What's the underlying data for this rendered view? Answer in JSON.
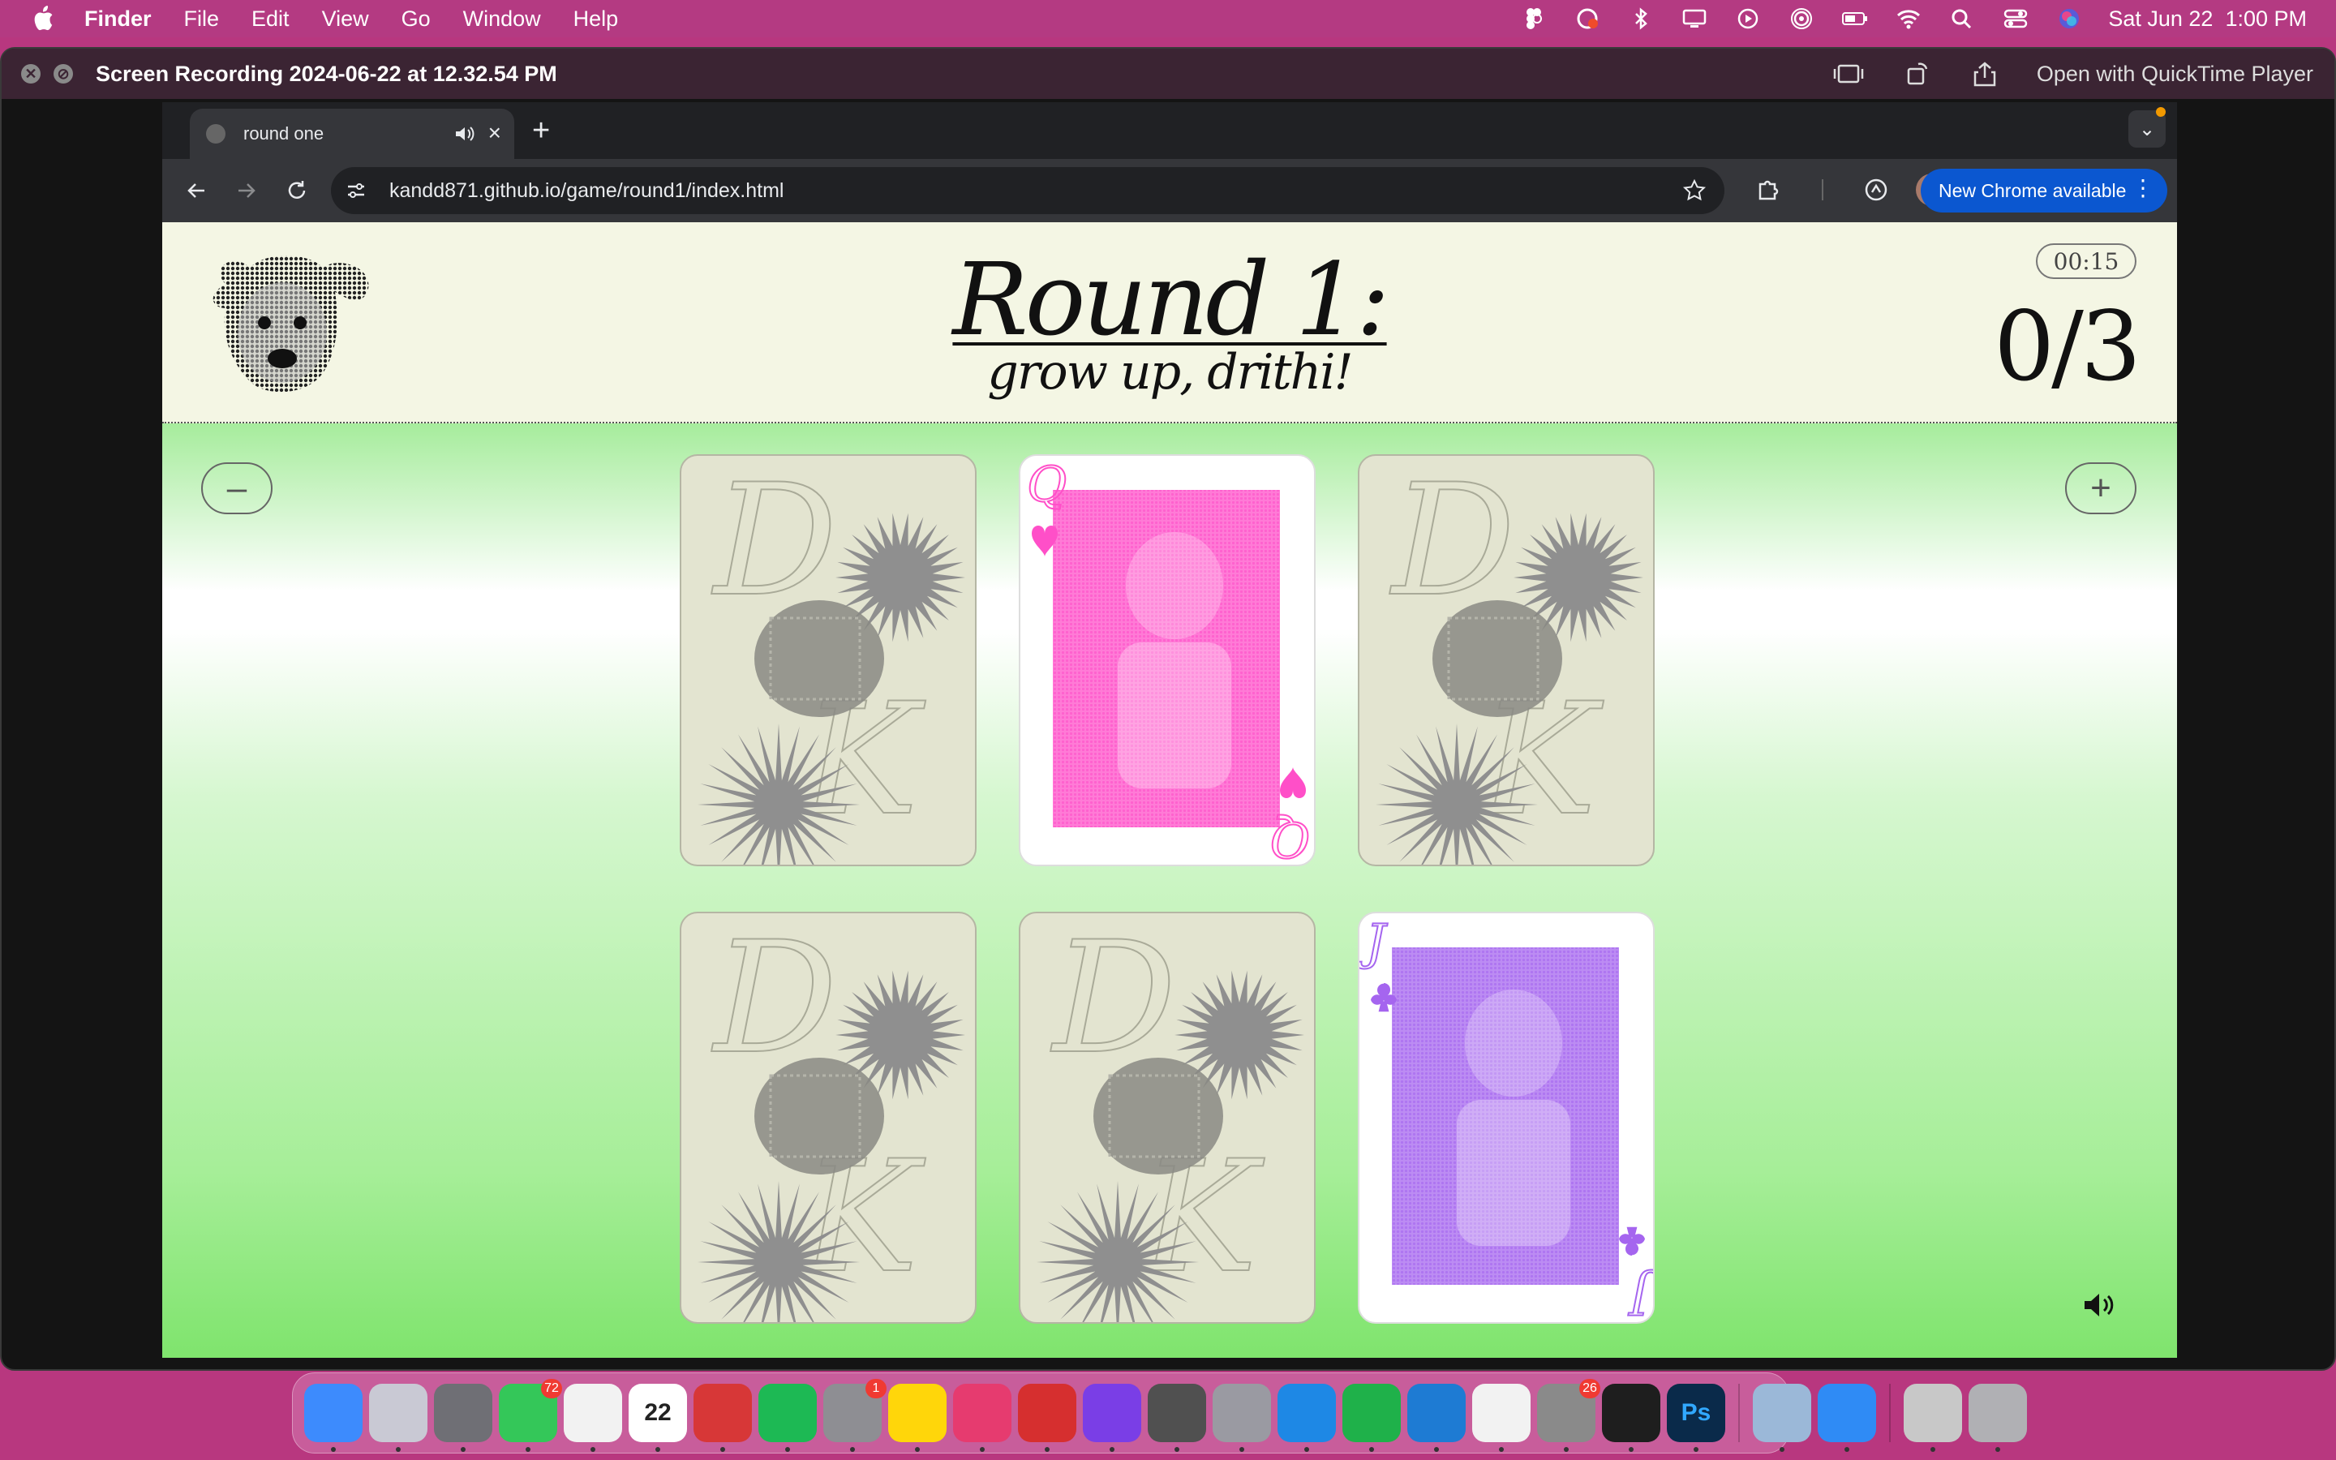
{
  "menubar": {
    "app_name": "Finder",
    "menus": [
      "File",
      "Edit",
      "View",
      "Go",
      "Window",
      "Help"
    ],
    "clock": "Sat Jun 22  1:00 PM"
  },
  "quicktime": {
    "title": "Screen Recording 2024-06-22 at 12.32.54 PM",
    "open_with": "Open with QuickTime Player"
  },
  "browser": {
    "tab_title": "round one",
    "url": "kandd871.github.io/game/round1/index.html",
    "new_chrome_label": "New Chrome available"
  },
  "game": {
    "title": "Round 1:",
    "subtitle": "grow up, drithi!",
    "timer": "00:15",
    "score": "0/3",
    "zoom_out_label": "–",
    "zoom_in_label": "+",
    "cards": [
      {
        "state": "back"
      },
      {
        "state": "face",
        "suit": "heart",
        "color": "#ff4fc8",
        "rank": "Q"
      },
      {
        "state": "back"
      },
      {
        "state": "back"
      },
      {
        "state": "back"
      },
      {
        "state": "face",
        "suit": "club",
        "color": "#a565ef",
        "rank": "J"
      }
    ]
  },
  "dock": {
    "apps": [
      {
        "name": "Finder",
        "color": "#3d8bfd"
      },
      {
        "name": "Launchpad",
        "color": "#c9c9d4"
      },
      {
        "name": "Screenshot",
        "color": "#6f6f75"
      },
      {
        "name": "Messages",
        "color": "#34c759",
        "badge": "72"
      },
      {
        "name": "Photos",
        "color": "#f2f2f2"
      },
      {
        "name": "Calendar",
        "color": "#ffffff",
        "text": "22"
      },
      {
        "name": "Photo Booth",
        "color": "#d73737"
      },
      {
        "name": "Spotify",
        "color": "#1db954"
      },
      {
        "name": "System Settings",
        "color": "#8e8e93",
        "badge": "1"
      },
      {
        "name": "Notes",
        "color": "#ffd60a"
      },
      {
        "name": "Creative Cloud",
        "color": "#e63b6f"
      },
      {
        "name": "Acrobat",
        "color": "#d62f2f"
      },
      {
        "name": "GitHub Desktop",
        "color": "#7a3ee6"
      },
      {
        "name": "Calculator",
        "color": "#505050"
      },
      {
        "name": "Dictionary",
        "color": "#9a9aa2"
      },
      {
        "name": "Safari",
        "color": "#1e88e5"
      },
      {
        "name": "Numbers",
        "color": "#1fb14a"
      },
      {
        "name": "VS Code",
        "color": "#1e7bd3"
      },
      {
        "name": "Chrome",
        "color": "#f2f2f2"
      },
      {
        "name": "WhatsApp",
        "color": "#8a8a8a",
        "badge": "26"
      },
      {
        "name": "Figma",
        "color": "#1e1e1e"
      },
      {
        "name": "Photoshop",
        "color": "#0a2a4a",
        "text": "Ps"
      },
      {
        "name": "Preview",
        "color": "#9bb8d8"
      },
      {
        "name": "Mail",
        "color": "#2f8bf5"
      },
      {
        "name": "Downloads",
        "color": "#c8c8c8"
      },
      {
        "name": "Trash",
        "color": "#b0b0b4"
      }
    ]
  }
}
